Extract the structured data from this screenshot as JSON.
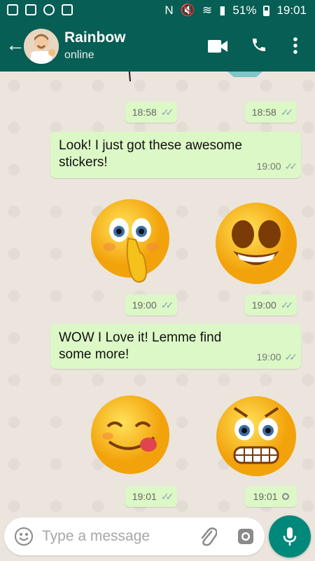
{
  "status_bar": {
    "battery": "51%",
    "time": "19:01"
  },
  "contact": {
    "name": "Rainbow",
    "status": "online"
  },
  "messages": {
    "top_left_time": "18:58",
    "top_right_time": "18:58",
    "msg1_text": "Look! I just got these awesome stickers!",
    "msg1_time": "19:00",
    "sticker_row1_left_time": "19:00",
    "sticker_row1_right_time": "19:00",
    "msg2_text": "WOW I Love it! Lemme find some more!",
    "msg2_time": "19:00",
    "sticker_row2_left_time": "19:01",
    "sticker_row2_right_time": "19:01"
  },
  "composer": {
    "placeholder": "Type a message"
  },
  "colors": {
    "header": "#075e54",
    "bubble": "#dcf8c6",
    "fab": "#00897b",
    "wallpaper": "#ece5dd"
  }
}
